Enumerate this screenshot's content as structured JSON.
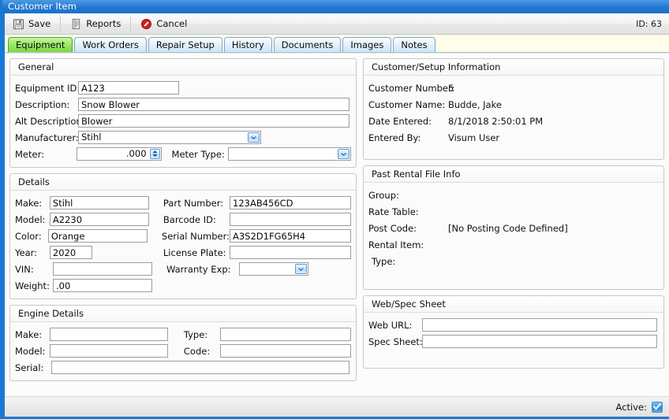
{
  "window": {
    "title": "Customer Item"
  },
  "toolbar": {
    "save_label": "Save",
    "reports_label": "Reports",
    "cancel_label": "Cancel",
    "id_label": "ID: 63",
    "icons": [
      "save-floppy-icon",
      "report-page-icon",
      "cancel-prohibited-icon"
    ]
  },
  "tabs": [
    {
      "label": "Equipment",
      "active": true
    },
    {
      "label": "Work Orders",
      "active": false
    },
    {
      "label": "Repair Setup",
      "active": false
    },
    {
      "label": "History",
      "active": false
    },
    {
      "label": "Documents",
      "active": false
    },
    {
      "label": "Images",
      "active": false
    },
    {
      "label": "Notes",
      "active": false
    }
  ],
  "general": {
    "title": "General",
    "equipment_id": {
      "label": "Equipment ID:",
      "value": "A123"
    },
    "description": {
      "label": "Description:",
      "value": "Snow Blower"
    },
    "alt_description": {
      "label": "Alt Description:",
      "value": "Blower"
    },
    "manufacturer": {
      "label": "Manufacturer:",
      "value": "Stihl"
    },
    "meter": {
      "label": "Meter:",
      "value": ".000"
    },
    "meter_type": {
      "label": "Meter Type:",
      "value": ""
    }
  },
  "customer_setup": {
    "title": "Customer/Setup Information",
    "customer_number": {
      "label": "Customer Number:",
      "value": "5"
    },
    "customer_name": {
      "label": "Customer Name:",
      "value": "Budde, Jake"
    },
    "date_entered": {
      "label": "Date Entered:",
      "value": "8/1/2018 2:50:01 PM"
    },
    "entered_by": {
      "label": "Entered By:",
      "value": "Visum User"
    }
  },
  "details": {
    "title": "Details",
    "make": {
      "label": "Make:",
      "value": "Stihl"
    },
    "model": {
      "label": "Model:",
      "value": "A2230"
    },
    "color": {
      "label": "Color:",
      "value": "Orange"
    },
    "year": {
      "label": "Year:",
      "value": "2020"
    },
    "vin": {
      "label": "VIN:",
      "value": ""
    },
    "weight": {
      "label": "Weight:",
      "value": ".00"
    },
    "part_number": {
      "label": "Part Number:",
      "value": "123AB456CD"
    },
    "barcode_id": {
      "label": "Barcode ID:",
      "value": ""
    },
    "serial_number": {
      "label": "Serial Number:",
      "value": "A3S2D1FG65H4"
    },
    "license_plate": {
      "label": "License Plate:",
      "value": ""
    },
    "warranty_exp": {
      "label": "Warranty Exp:",
      "value": ""
    }
  },
  "past_rental": {
    "title": "Past Rental File Info",
    "group": {
      "label": "Group:",
      "value": ""
    },
    "rate_table": {
      "label": "Rate Table:",
      "value": ""
    },
    "post_code": {
      "label": "Post Code:",
      "value": "[No Posting Code Defined]"
    },
    "rental_item": {
      "label": "Rental Item:",
      "value": ""
    },
    "type": {
      "label": "Type:",
      "value": ""
    }
  },
  "engine_details": {
    "title": "Engine Details",
    "make": {
      "label": "Make:",
      "value": ""
    },
    "model": {
      "label": "Model:",
      "value": ""
    },
    "serial": {
      "label": "Serial:",
      "value": ""
    },
    "type": {
      "label": "Type:",
      "value": ""
    },
    "code": {
      "label": "Code:",
      "value": ""
    }
  },
  "web_spec": {
    "title": "Web/Spec Sheet",
    "web_url": {
      "label": "Web URL:",
      "value": ""
    },
    "spec_sheet": {
      "label": "Spec Sheet:",
      "value": ""
    }
  },
  "statusbar": {
    "active_label": "Active:",
    "active_checked": true
  },
  "colors": {
    "titlebar_blue": "#1f75cf",
    "window_border": "#1879d4",
    "active_tab_green": "#79dc3e",
    "tab_blue": "#cfe4f7",
    "tabstrip_cream": "#fdfdea",
    "cancel_red": "#cc2020"
  }
}
